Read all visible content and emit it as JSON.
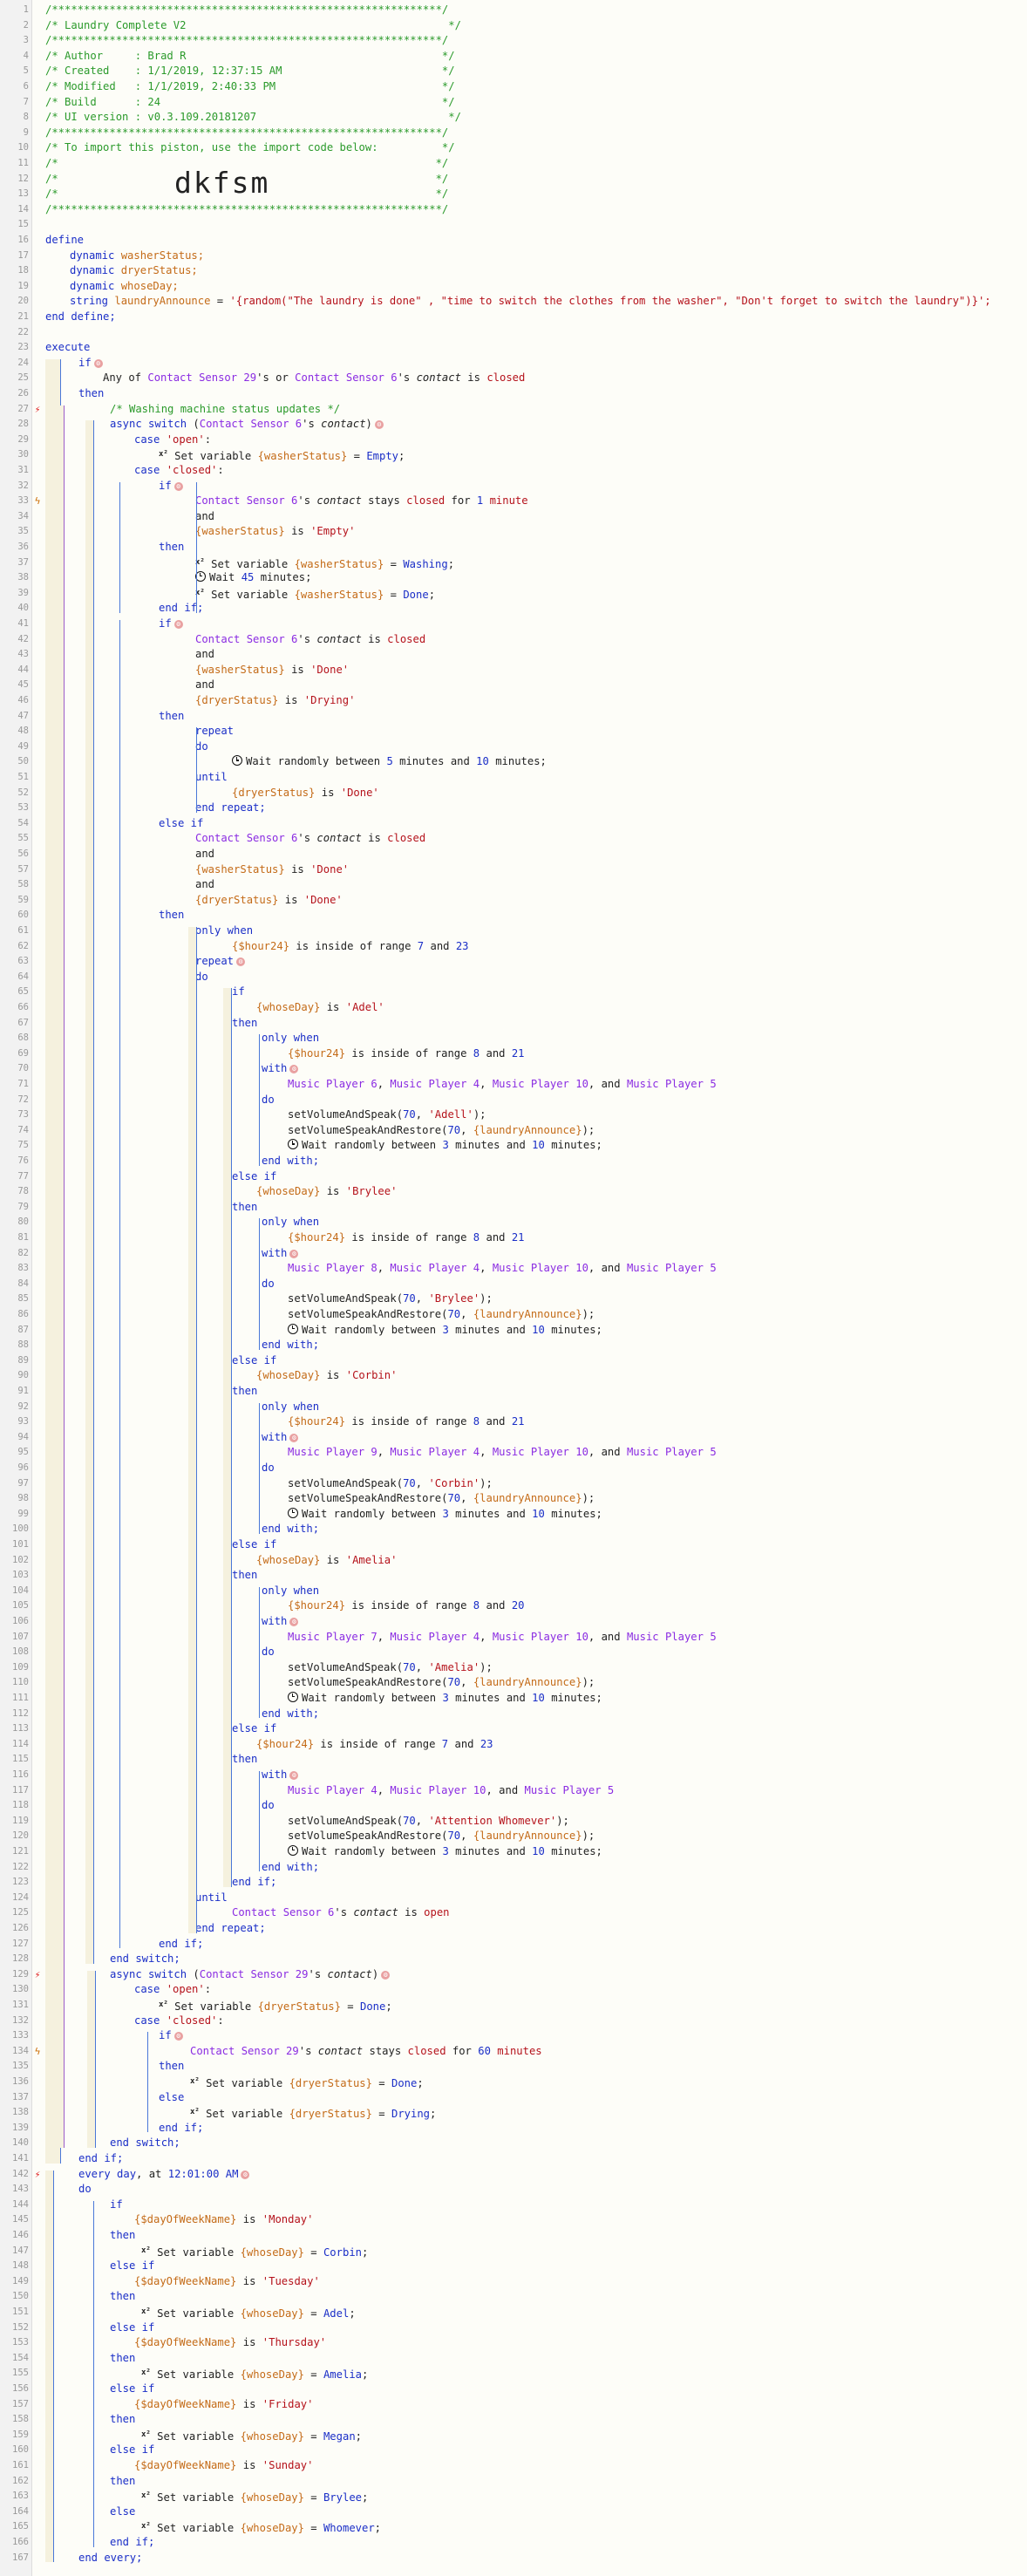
{
  "header": {
    "stars": "/*************************************************************/",
    "title_line": "/* Laundry Complete V2                                         */",
    "author_line": "/* Author     : Brad R                                        */",
    "created_line": "/* Created    : 1/1/2019, 12:37:15 AM                         */",
    "modified_line": "/* Modified   : 1/1/2019, 2:40:33 PM                          */",
    "build_line": "/* Build      : 24                                            */",
    "ui_line": "/* UI version : v0.3.109.20181207                              */",
    "import_line": "/* To import this piston, use the import code below:          */",
    "blank_line": "/*                                                           */",
    "import_code": "dkfsm"
  },
  "lines": [
    {
      "n": "1",
      "t": "hdr1"
    },
    {
      "n": "2",
      "t": "hdr2"
    },
    {
      "n": "3",
      "t": "hdr1"
    },
    {
      "n": "4",
      "t": "hdr3"
    },
    {
      "n": "5",
      "t": "hdr4"
    },
    {
      "n": "6",
      "t": "hdr5"
    },
    {
      "n": "7",
      "t": "hdr6"
    },
    {
      "n": "8",
      "t": "hdr7"
    },
    {
      "n": "9",
      "t": "hdr1"
    },
    {
      "n": "10",
      "t": "hdr8"
    },
    {
      "n": "11",
      "t": "hdr9"
    },
    {
      "n": "12",
      "t": "hdr9"
    },
    {
      "n": "13",
      "t": "hdr9"
    },
    {
      "n": "14",
      "t": "hdr1"
    }
  ],
  "code": {
    "define": "define",
    "dynamic": "dynamic",
    "string": "string",
    "washerStatus": "washerStatus;",
    "dryerStatus": "dryerStatus;",
    "whoseDay": "whoseDay;",
    "laundryAnnounce": "laundryAnnounce",
    "announce_value": "'{random(\"The laundry is done\" , \"time to switch the clothes from the washer\", \"Don't forget to switch the laundry\")}';",
    "end_define": "end define;",
    "execute": "execute"
  },
  "gutter": {
    "numbers": [
      "1",
      "2",
      "3",
      "4",
      "5",
      "6",
      "7",
      "8",
      "9",
      "10",
      "11",
      "12",
      "13",
      "14",
      "15",
      "16",
      "17",
      "18",
      "19",
      "20",
      "21",
      "22",
      "23",
      "24",
      "25",
      "26",
      "27",
      "28",
      "29",
      "30",
      "31",
      "32",
      "33",
      "34",
      "35",
      "36",
      "37",
      "38",
      "39",
      "40",
      "41",
      "42",
      "43",
      "44",
      "45",
      "46",
      "47",
      "48",
      "49",
      "50",
      "51",
      "52",
      "53",
      "54",
      "55",
      "56",
      "57",
      "58",
      "59",
      "60",
      "61",
      "62",
      "63",
      "64",
      "65",
      "66",
      "67",
      "68",
      "69",
      "70",
      "71",
      "72",
      "73",
      "74",
      "75",
      "76",
      "77",
      "78",
      "79",
      "80",
      "81",
      "82",
      "83",
      "84",
      "85",
      "86",
      "87",
      "88",
      "89",
      "90",
      "91",
      "92",
      "93",
      "94",
      "95",
      "96",
      "97",
      "98",
      "99",
      "100",
      "101",
      "102",
      "103",
      "104",
      "105",
      "106",
      "107",
      "108",
      "109",
      "110",
      "111",
      "112",
      "113",
      "114",
      "115",
      "116",
      "117",
      "118",
      "119",
      "120",
      "121",
      "122",
      "123",
      "124",
      "125",
      "126",
      "127",
      "128",
      "129",
      "130",
      "131",
      "132",
      "133",
      "134",
      "135",
      "136",
      "137",
      "138",
      "139",
      "140",
      "141",
      "142",
      "143",
      "144",
      "145",
      "146",
      "147",
      "148",
      "149",
      "150",
      "151",
      "152",
      "153",
      "154",
      "155",
      "156",
      "157",
      "158",
      "159",
      "160",
      "161",
      "162",
      "163",
      "164",
      "165",
      "166",
      "167"
    ]
  },
  "colors": {
    "keyword": "#1a2ec7",
    "variable": "#c46b18",
    "device": "#8a2be2",
    "string": "#b5121b",
    "comment": "#2b9a2b"
  }
}
